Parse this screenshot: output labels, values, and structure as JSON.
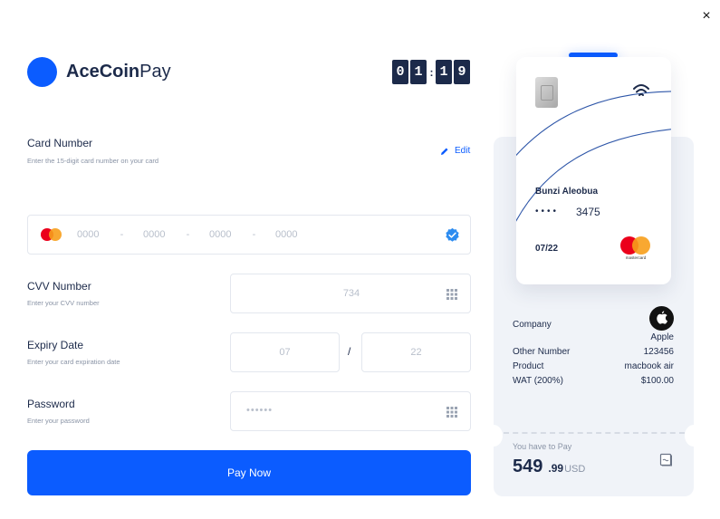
{
  "window": {
    "close_symbol": "×"
  },
  "brand": {
    "name_bold": "AceCoin",
    "name_light": "Pay",
    "logo_color": "#0b5cff"
  },
  "timer": {
    "digits": [
      "0",
      "1",
      "1",
      "9"
    ],
    "separator": ":"
  },
  "card_number": {
    "label": "Card Number",
    "hint": "Enter the 15-digit card number on your card",
    "edit_label": "Edit",
    "groups": [
      "0000",
      "0000",
      "0000",
      "0000"
    ],
    "group_separator": "-",
    "verified": true
  },
  "cvv": {
    "label": "CVV Number",
    "hint": "Enter your CVV number",
    "placeholder": "734"
  },
  "expiry": {
    "label": "Expiry Date",
    "hint": "Enter your card expiration date",
    "month_placeholder": "07",
    "year_placeholder": "22",
    "separator": "/"
  },
  "password": {
    "label": "Password",
    "hint": "Enter your password",
    "placeholder": "••••••"
  },
  "pay_button": {
    "label": "Pay Now"
  },
  "card_preview": {
    "holder": "Bunzi Aleobua",
    "masked_dots": "••••",
    "last4": "3475",
    "expiry": "07/22",
    "network": "mastercard"
  },
  "summary": {
    "company_label": "Company",
    "company_value": "Apple",
    "rows": [
      {
        "label": "Other Number",
        "value": "123456"
      },
      {
        "label": "Product",
        "value": "macbook air"
      },
      {
        "label": "WAT (200%)",
        "value": "$100.00"
      }
    ]
  },
  "total": {
    "label": "You have to Pay",
    "integer": "549",
    "decimal": ".99",
    "currency": "USD"
  },
  "colors": {
    "accent": "#0b5cff",
    "navy": "#1c2a4a",
    "muted": "#8a94a6",
    "panel": "#f0f3f8"
  }
}
